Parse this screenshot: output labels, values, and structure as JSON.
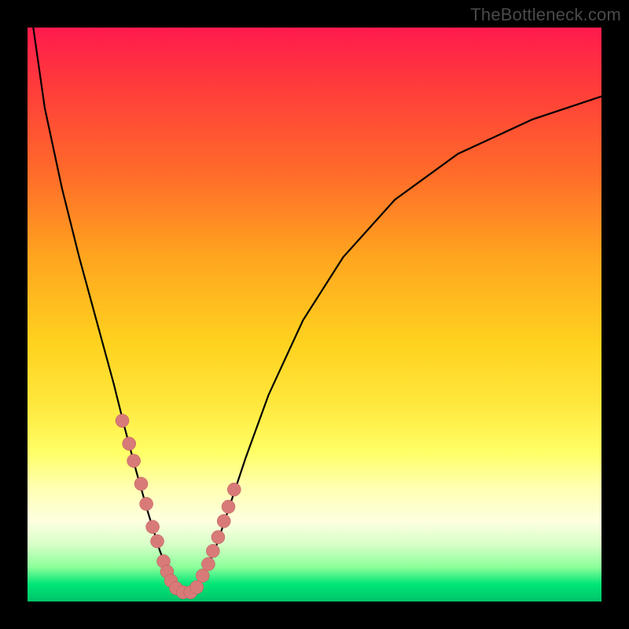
{
  "attribution": "TheBottleneck.com",
  "colors": {
    "frame": "#000000",
    "dot_fill": "#d87a78",
    "dot_stroke": "#b85a5a",
    "curve": "#000000"
  },
  "chart_data": {
    "type": "line",
    "title": "",
    "xlabel": "",
    "ylabel": "",
    "xlim": [
      0,
      100
    ],
    "ylim": [
      0,
      100
    ],
    "grid": false,
    "note": "Axes are unlabeled in the source image; x/y values below are estimated from pixel positions (0–100 normalized). Curve is a V-shaped bottleneck curve; dots are sampled curve points near the minimum.",
    "series": [
      {
        "name": "bottleneck-curve",
        "x": [
          1,
          3,
          6,
          9,
          12,
          15,
          17,
          19,
          21,
          23,
          24.5,
          26,
          27,
          28,
          29.5,
          31,
          33,
          35,
          38,
          42,
          48,
          55,
          64,
          75,
          88,
          100
        ],
        "y": [
          100,
          86,
          72,
          60,
          49,
          38,
          30,
          22.5,
          15.5,
          9,
          5,
          2.5,
          1.5,
          1.5,
          2.5,
          5,
          10,
          16,
          25,
          36,
          49,
          60,
          70,
          78,
          84,
          88
        ]
      }
    ],
    "scatter": [
      {
        "name": "curve-dots",
        "x": [
          16.5,
          17.7,
          18.5,
          19.8,
          20.7,
          21.8,
          22.6,
          23.7,
          24.3,
          25.0,
          25.9,
          27.1,
          28.4,
          29.5,
          30.5,
          31.5,
          32.3,
          33.2,
          34.2,
          35.0,
          36.0
        ],
        "y": [
          31.5,
          27.5,
          24.5,
          20.5,
          17.0,
          13.0,
          10.5,
          7.0,
          5.2,
          3.6,
          2.3,
          1.6,
          1.6,
          2.5,
          4.5,
          6.5,
          8.8,
          11.2,
          14.0,
          16.5,
          19.5
        ]
      }
    ]
  }
}
